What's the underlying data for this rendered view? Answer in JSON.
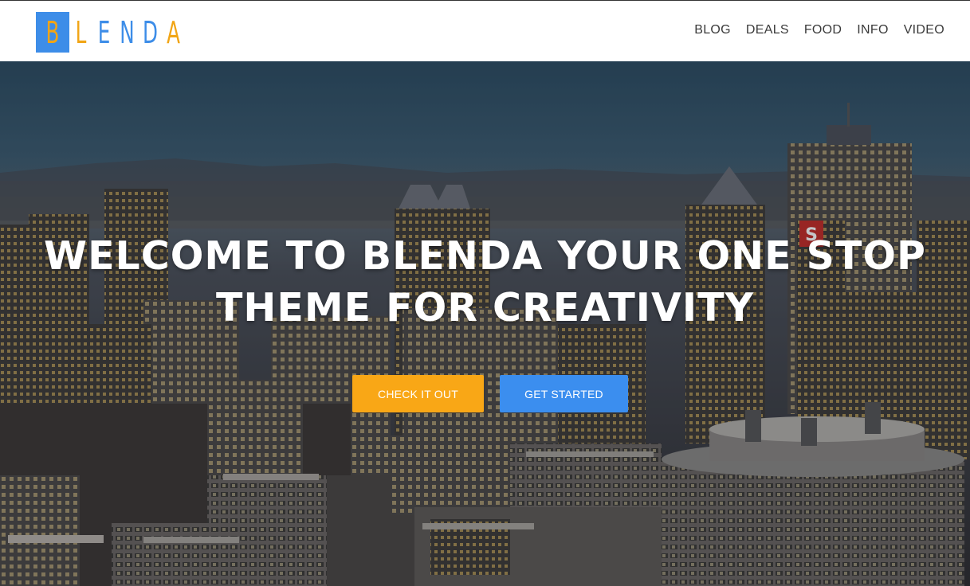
{
  "logo": {
    "letters": [
      "B",
      "L",
      "E",
      "N",
      "D",
      "A"
    ]
  },
  "nav": {
    "items": [
      {
        "label": "BLOG"
      },
      {
        "label": "DEALS"
      },
      {
        "label": "FOOD"
      },
      {
        "label": "INFO"
      },
      {
        "label": "VIDEO"
      }
    ]
  },
  "hero": {
    "title_line1": "WELCOME TO BLENDA YOUR ONE STOP",
    "title_line2": "THEME FOR CREATIVITY",
    "primary_button": "CHECK IT OUT",
    "secondary_button": "GET STARTED",
    "background": "city-skyline-night-photo"
  },
  "colors": {
    "accent_orange": "#f9a716",
    "accent_blue": "#3b8eef",
    "logo_blue": "#3d8de8",
    "logo_orange": "#f1a516"
  }
}
